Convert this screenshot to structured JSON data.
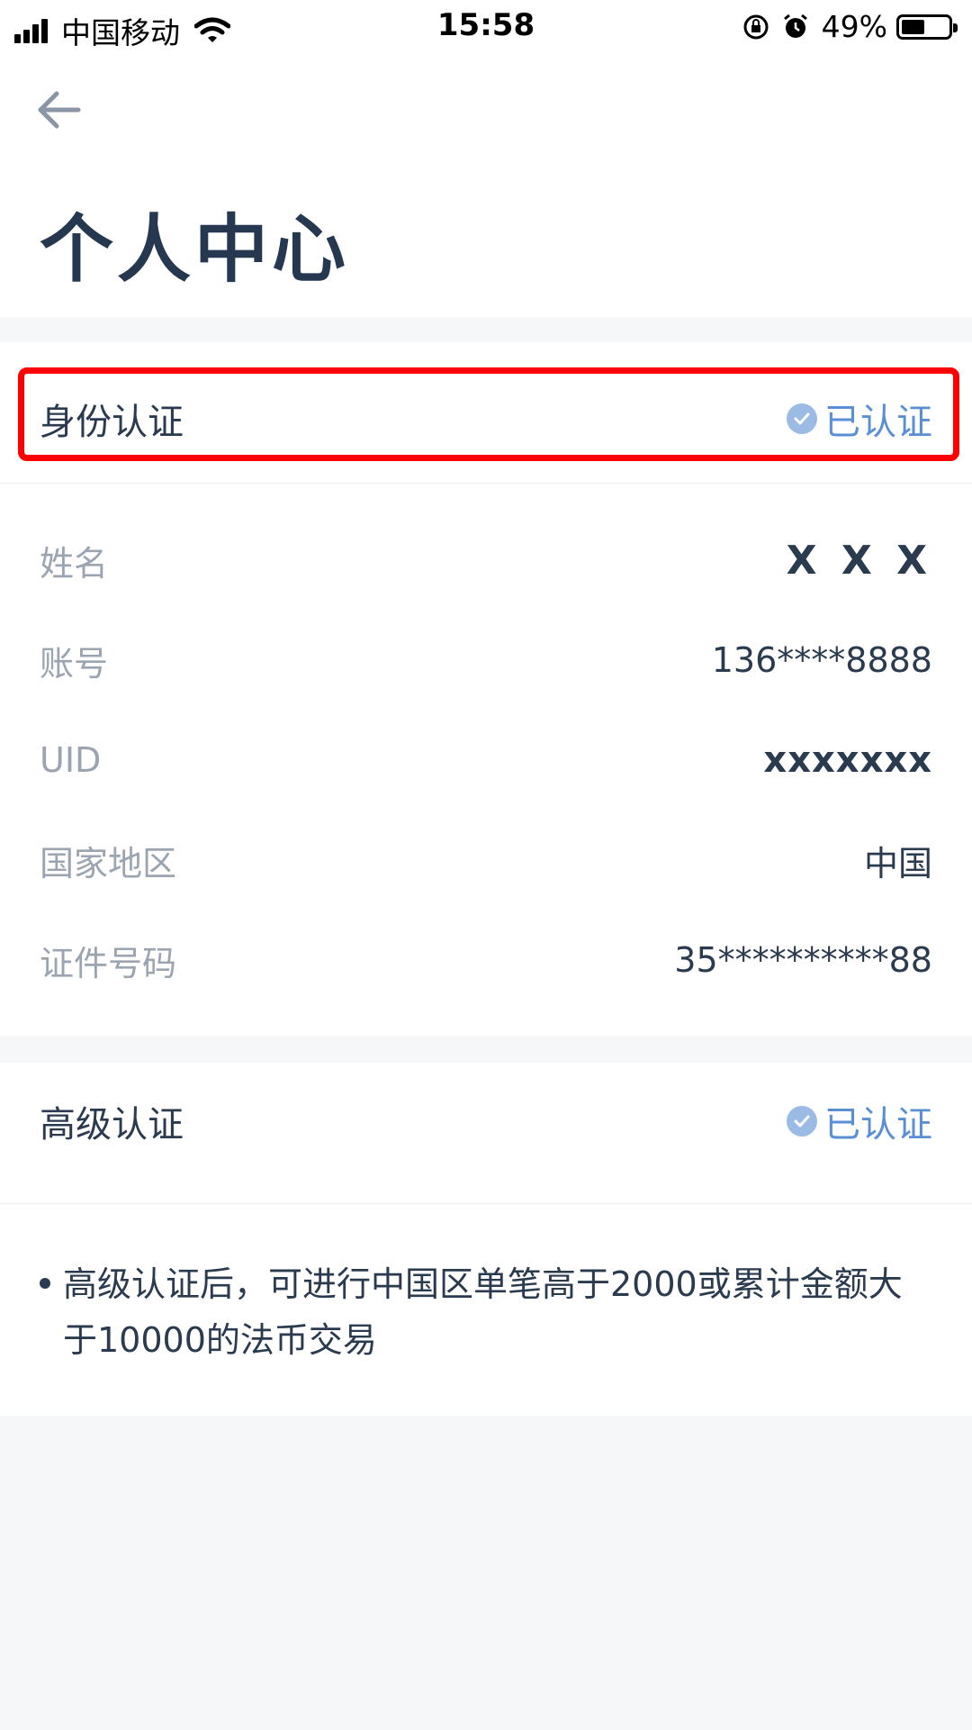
{
  "status_bar": {
    "carrier": "中国移动",
    "time": "15:58",
    "battery": "49%",
    "battery_level": 0.49
  },
  "header": {
    "title": "个人中心"
  },
  "identity": {
    "label": "身份认证",
    "status": "已认证",
    "rows": [
      {
        "label": "姓名",
        "value": "X X X"
      },
      {
        "label": "账号",
        "value": "136****8888"
      },
      {
        "label": "UID",
        "value": "xxxxxxx"
      },
      {
        "label": "国家地区",
        "value": "中国"
      },
      {
        "label": "证件号码",
        "value": "35**********88"
      }
    ]
  },
  "advanced": {
    "label": "高级认证",
    "status": "已认证",
    "note": "高级认证后，可进行中国区单笔高于2000或累计金额大于10000的法币交易"
  },
  "colors": {
    "accent": "#5a8fd6",
    "highlight": "#ff0000",
    "title": "#253850"
  }
}
